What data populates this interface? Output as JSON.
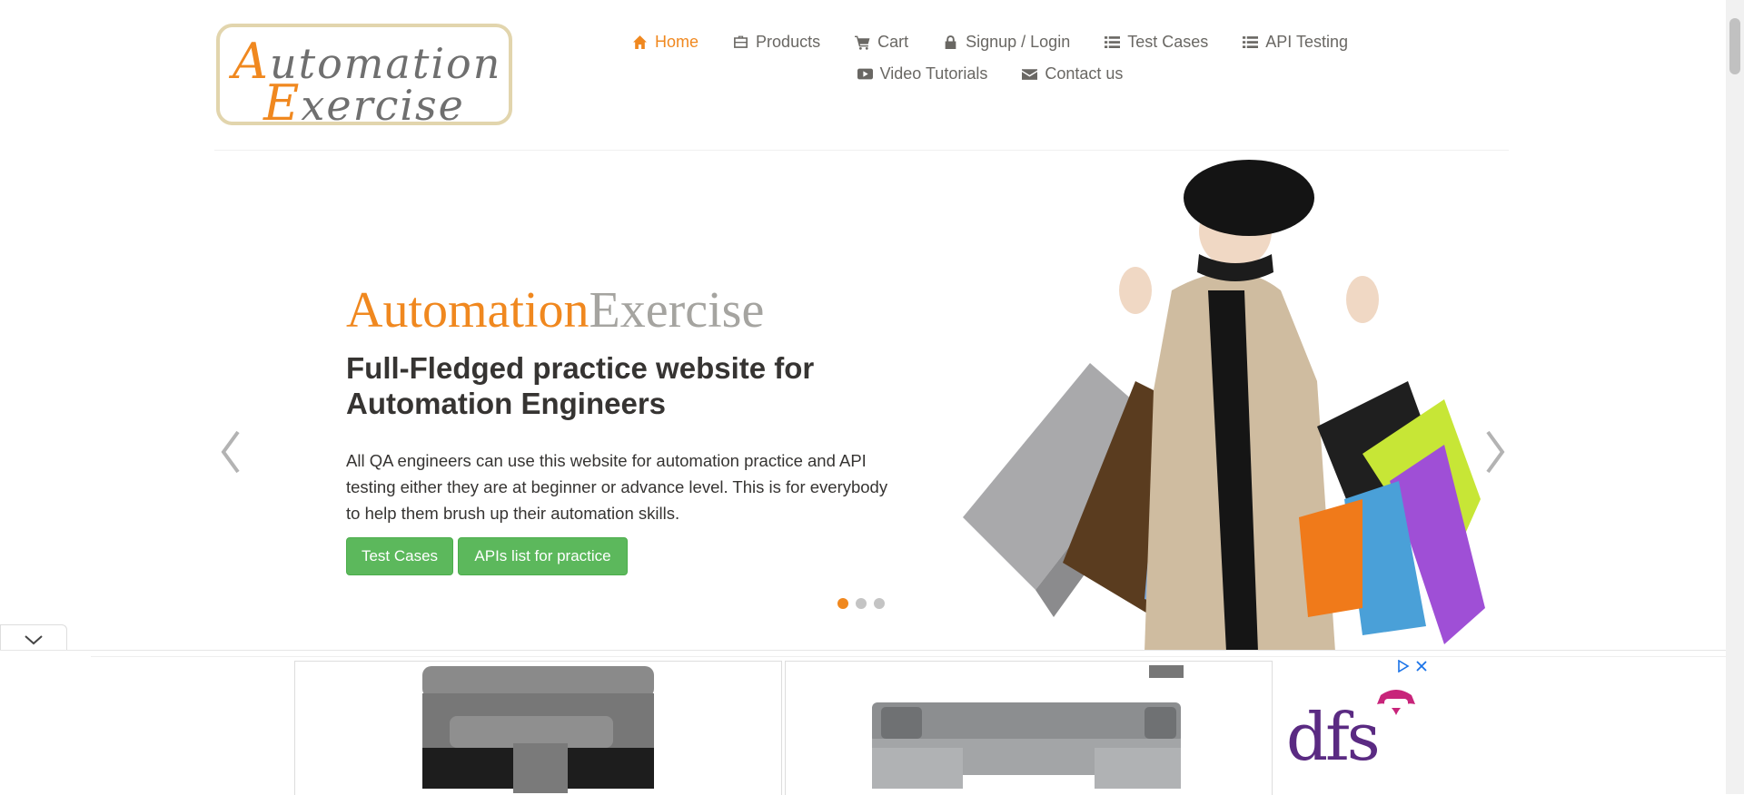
{
  "logo": {
    "line1_cap": "A",
    "line1_rest": "utomation",
    "line2_cap": "E",
    "line2_rest": "xercise"
  },
  "nav": {
    "row1": [
      {
        "label": "Home",
        "icon": "home-icon",
        "active": true
      },
      {
        "label": "Products",
        "icon": "briefcase-icon"
      },
      {
        "label": "Cart",
        "icon": "cart-icon"
      },
      {
        "label": "Signup / Login",
        "icon": "lock-icon"
      },
      {
        "label": "Test Cases",
        "icon": "list-icon"
      },
      {
        "label": "API Testing",
        "icon": "list-icon"
      }
    ],
    "row2": [
      {
        "label": "Video Tutorials",
        "icon": "youtube-icon"
      },
      {
        "label": "Contact us",
        "icon": "envelope-icon"
      }
    ]
  },
  "slider": {
    "title_a": "Automation",
    "title_b": "Exercise",
    "heading": "Full-Fledged practice website for Automation Engineers",
    "text": "All QA engineers can use this website for automation practice and API testing either they are at beginner or advance level. This is for everybody to help them brush up their automation skills.",
    "button_test_cases": "Test Cases",
    "button_apis": "APIs list for practice",
    "active_slide": 1,
    "slide_count": 3
  },
  "ad": {
    "brand": "dfs"
  },
  "colors": {
    "accent": "#f0881f",
    "button_green": "#5cb85c",
    "title_gray": "#a5a4a0",
    "brand_purple": "#5a2a82"
  }
}
